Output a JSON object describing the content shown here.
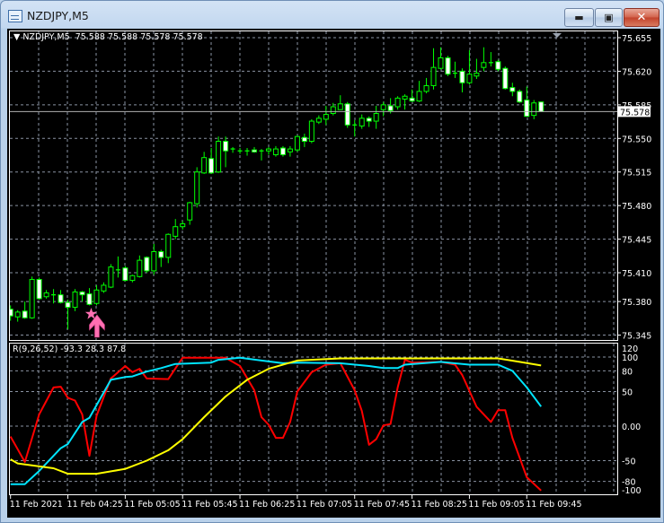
{
  "window": {
    "title": "NZDJPY,M5",
    "buttons": {
      "minimize_icon": "minimize-icon",
      "maximize_icon": "restore-icon",
      "close_icon": "close-icon"
    }
  },
  "chart": {
    "symbol_label": "NZDJPY,M5",
    "ohlc_label": "75.588 75.588 75.578 75.578",
    "last_price": "75.578",
    "colors": {
      "background": "#000000",
      "bull_outline": "#00ff00",
      "bear_fill": "#ffffff",
      "grid": "#8a93a3",
      "signal": "#ff6fb2"
    },
    "price_axis": [
      "75.655",
      "75.620",
      "75.585",
      "75.550",
      "75.515",
      "75.480",
      "75.445",
      "75.410",
      "75.380",
      "75.345"
    ],
    "time_axis": [
      "11 Feb 2021",
      "11 Feb 04:25",
      "11 Feb 05:05",
      "11 Feb 05:45",
      "11 Feb 06:25",
      "11 Feb 07:05",
      "11 Feb 07:45",
      "11 Feb 08:25",
      "11 Feb 09:05",
      "11 Feb 09:45"
    ],
    "signals": [
      {
        "icon": "star-icon",
        "time": "04:40"
      },
      {
        "icon": "arrow-up-icon",
        "time": "04:45"
      }
    ]
  },
  "chart_data": [
    {
      "type": "candlestick",
      "title": "NZDJPY,M5",
      "first_time": "03:45",
      "columns": [
        "open",
        "high",
        "low",
        "close"
      ],
      "candles": [
        [
          75.372,
          75.376,
          75.36,
          75.365
        ],
        [
          75.364,
          75.371,
          75.359,
          75.369
        ],
        [
          75.37,
          75.38,
          75.362,
          75.363
        ],
        [
          75.363,
          75.406,
          75.362,
          75.403
        ],
        [
          75.403,
          75.405,
          75.382,
          75.383
        ],
        [
          75.385,
          75.392,
          75.383,
          75.389
        ],
        [
          75.387,
          75.393,
          75.378,
          75.387
        ],
        [
          75.387,
          75.392,
          75.378,
          75.379
        ],
        [
          75.379,
          75.382,
          75.351,
          75.374
        ],
        [
          75.374,
          75.393,
          75.37,
          75.39
        ],
        [
          75.39,
          75.391,
          75.38,
          75.387
        ],
        [
          75.388,
          75.394,
          75.376,
          75.377
        ],
        [
          75.378,
          75.397,
          75.376,
          75.392
        ],
        [
          75.391,
          75.4,
          75.389,
          75.397
        ],
        [
          75.395,
          75.419,
          75.394,
          75.416
        ],
        [
          75.413,
          75.427,
          75.405,
          75.413
        ],
        [
          75.415,
          75.417,
          75.401,
          75.402
        ],
        [
          75.402,
          75.408,
          75.4,
          75.407
        ],
        [
          75.406,
          75.428,
          75.405,
          75.423
        ],
        [
          75.426,
          75.427,
          75.41,
          75.412
        ],
        [
          75.412,
          75.44,
          75.408,
          75.432
        ],
        [
          75.432,
          75.434,
          75.416,
          75.426
        ],
        [
          75.426,
          75.451,
          75.42,
          75.45
        ],
        [
          75.448,
          75.466,
          75.445,
          75.458
        ],
        [
          75.458,
          75.464,
          75.455,
          75.461
        ],
        [
          75.465,
          75.484,
          75.46,
          75.483
        ],
        [
          75.482,
          75.52,
          75.478,
          75.515
        ],
        [
          75.514,
          75.536,
          75.513,
          75.53
        ],
        [
          75.529,
          75.54,
          75.513,
          75.514
        ],
        [
          75.515,
          75.552,
          75.514,
          75.547
        ],
        [
          75.547,
          75.552,
          75.52,
          75.537
        ],
        [
          75.539,
          75.541,
          75.535,
          75.539
        ],
        [
          75.537,
          75.54,
          75.534,
          75.537
        ],
        [
          75.537,
          75.54,
          75.532,
          75.537
        ],
        [
          75.538,
          75.541,
          75.535,
          75.536
        ],
        [
          75.537,
          75.539,
          75.527,
          75.537
        ],
        [
          75.537,
          75.541,
          75.533,
          75.539
        ],
        [
          75.533,
          75.542,
          75.531,
          75.539
        ],
        [
          75.54,
          75.542,
          75.531,
          75.533
        ],
        [
          75.536,
          75.542,
          75.531,
          75.539
        ],
        [
          75.538,
          75.553,
          75.536,
          75.552
        ],
        [
          75.551,
          75.555,
          75.541,
          75.547
        ],
        [
          75.547,
          75.57,
          75.545,
          75.568
        ],
        [
          75.567,
          75.574,
          75.565,
          75.571
        ],
        [
          75.57,
          75.584,
          75.564,
          75.575
        ],
        [
          75.576,
          75.587,
          75.574,
          75.583
        ],
        [
          75.58,
          75.595,
          75.58,
          75.586
        ],
        [
          75.586,
          75.588,
          75.561,
          75.564
        ],
        [
          75.564,
          75.569,
          75.552,
          75.564
        ],
        [
          75.563,
          75.575,
          75.56,
          75.571
        ],
        [
          75.571,
          75.573,
          75.562,
          75.568
        ],
        [
          75.568,
          75.584,
          75.56,
          75.576
        ],
        [
          75.58,
          75.588,
          75.573,
          75.585
        ],
        [
          75.584,
          75.592,
          75.576,
          75.579
        ],
        [
          75.583,
          75.594,
          75.58,
          75.592
        ],
        [
          75.591,
          75.596,
          75.58,
          75.594
        ],
        [
          75.592,
          75.601,
          75.588,
          75.589
        ],
        [
          75.589,
          75.61,
          75.588,
          75.599
        ],
        [
          75.599,
          75.613,
          75.597,
          75.605
        ],
        [
          75.605,
          75.644,
          75.601,
          75.624
        ],
        [
          75.623,
          75.645,
          75.622,
          75.634
        ],
        [
          75.634,
          75.636,
          75.615,
          75.617
        ],
        [
          75.618,
          75.63,
          75.613,
          75.618
        ],
        [
          75.62,
          75.623,
          75.598,
          75.608
        ],
        [
          75.608,
          75.642,
          75.606,
          75.617
        ],
        [
          75.615,
          75.633,
          75.612,
          75.618
        ],
        [
          75.624,
          75.645,
          75.62,
          75.629
        ],
        [
          75.629,
          75.64,
          75.625,
          75.629
        ],
        [
          75.63,
          75.632,
          75.62,
          75.622
        ],
        [
          75.623,
          75.625,
          75.601,
          75.602
        ],
        [
          75.603,
          75.608,
          75.594,
          75.599
        ],
        [
          75.599,
          75.601,
          75.587,
          75.588
        ],
        [
          75.59,
          75.604,
          75.573,
          75.573
        ],
        [
          75.574,
          75.59,
          75.57,
          75.587
        ],
        [
          75.588,
          75.588,
          75.578,
          75.578
        ]
      ],
      "ylim": [
        75.345,
        75.655
      ],
      "grid": true
    },
    {
      "type": "line",
      "label": "R(9,26,52) -93.3 28.3 87.8",
      "ylim": [
        -100,
        120
      ],
      "yticks": [
        "120",
        "100",
        "80",
        "50",
        "0.00",
        "-50",
        "-80",
        "-100"
      ],
      "grid": true,
      "series": [
        {
          "color": "#ff0000",
          "points": [
            [
              "03:45",
              -15
            ],
            [
              "03:55",
              -52
            ],
            [
              "04:05",
              17
            ],
            [
              "04:15",
              56
            ],
            [
              "04:20",
              57
            ],
            [
              "04:25",
              41
            ],
            [
              "04:30",
              37
            ],
            [
              "04:35",
              17
            ],
            [
              "04:40",
              -43
            ],
            [
              "04:45",
              15
            ],
            [
              "04:55",
              69
            ],
            [
              "05:05",
              87
            ],
            [
              "05:10",
              78
            ],
            [
              "05:15",
              83
            ],
            [
              "05:20",
              69
            ],
            [
              "05:35",
              68
            ],
            [
              "05:45",
              99
            ],
            [
              "06:15",
              99
            ],
            [
              "06:25",
              87
            ],
            [
              "06:35",
              52
            ],
            [
              "06:40",
              13
            ],
            [
              "06:45",
              2
            ],
            [
              "06:50",
              -17
            ],
            [
              "06:55",
              -17
            ],
            [
              "07:00",
              6
            ],
            [
              "07:05",
              50
            ],
            [
              "07:15",
              78
            ],
            [
              "07:25",
              89
            ],
            [
              "07:35",
              91
            ],
            [
              "07:45",
              52
            ],
            [
              "07:50",
              22
            ],
            [
              "07:55",
              -27
            ],
            [
              "08:00",
              -19
            ],
            [
              "08:05",
              1
            ],
            [
              "08:10",
              3
            ],
            [
              "08:15",
              56
            ],
            [
              "08:20",
              96
            ],
            [
              "08:25",
              92
            ],
            [
              "08:45",
              93
            ],
            [
              "08:55",
              89
            ],
            [
              "09:00",
              74
            ],
            [
              "09:10",
              28
            ],
            [
              "09:20",
              6
            ],
            [
              "09:25",
              23
            ],
            [
              "09:30",
              23
            ],
            [
              "09:35",
              -17
            ],
            [
              "09:45",
              -74
            ],
            [
              "09:55",
              -93.3
            ]
          ]
        },
        {
          "color": "#00e5ff",
          "points": [
            [
              "03:45",
              -84
            ],
            [
              "03:55",
              -84
            ],
            [
              "04:05",
              -65
            ],
            [
              "04:20",
              -32
            ],
            [
              "04:25",
              -26
            ],
            [
              "04:35",
              6
            ],
            [
              "04:40",
              12
            ],
            [
              "04:55",
              67
            ],
            [
              "05:05",
              71
            ],
            [
              "05:10",
              72
            ],
            [
              "05:20",
              79
            ],
            [
              "05:30",
              84
            ],
            [
              "05:40",
              90
            ],
            [
              "06:05",
              92
            ],
            [
              "06:10",
              96
            ],
            [
              "06:25",
              99
            ],
            [
              "06:40",
              95
            ],
            [
              "06:55",
              91
            ],
            [
              "07:05",
              92
            ],
            [
              "07:35",
              91
            ],
            [
              "07:55",
              87
            ],
            [
              "08:05",
              84
            ],
            [
              "08:15",
              84
            ],
            [
              "08:20",
              89
            ],
            [
              "08:45",
              93
            ],
            [
              "09:05",
              89
            ],
            [
              "09:25",
              89
            ],
            [
              "09:35",
              80
            ],
            [
              "09:45",
              56
            ],
            [
              "09:55",
              28.3
            ]
          ]
        },
        {
          "color": "#ffff00",
          "points": [
            [
              "03:45",
              -48
            ],
            [
              "03:50",
              -54
            ],
            [
              "04:15",
              -61
            ],
            [
              "04:25",
              -69
            ],
            [
              "04:45",
              -69
            ],
            [
              "05:05",
              -62
            ],
            [
              "05:20",
              -50
            ],
            [
              "05:35",
              -35
            ],
            [
              "05:45",
              -19
            ],
            [
              "06:00",
              13
            ],
            [
              "06:15",
              43
            ],
            [
              "06:30",
              67
            ],
            [
              "06:45",
              83
            ],
            [
              "07:05",
              95
            ],
            [
              "07:35",
              98
            ],
            [
              "09:25",
              98
            ],
            [
              "09:40",
              93
            ],
            [
              "09:55",
              87.8
            ]
          ]
        }
      ]
    }
  ]
}
